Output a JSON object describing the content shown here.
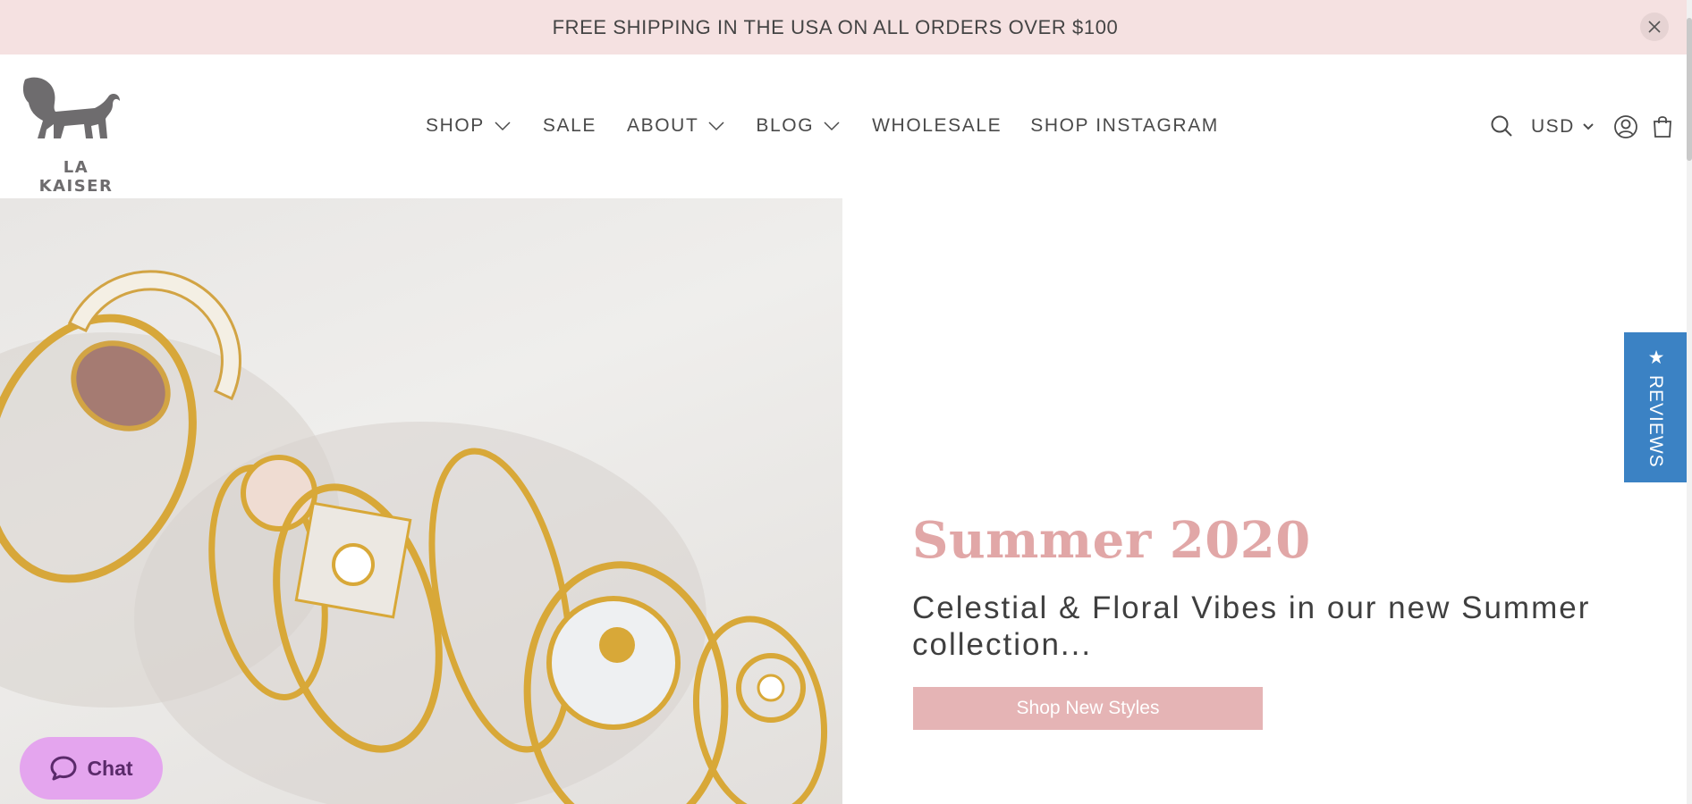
{
  "announcement": {
    "text": "FREE SHIPPING IN THE USA ON ALL ORDERS OVER $100"
  },
  "brand": {
    "name": "LA KAISER"
  },
  "nav": {
    "items": [
      {
        "label": "SHOP",
        "has_dropdown": true
      },
      {
        "label": "SALE",
        "has_dropdown": false
      },
      {
        "label": "ABOUT",
        "has_dropdown": true
      },
      {
        "label": "BLOG",
        "has_dropdown": true
      },
      {
        "label": "WHOLESALE",
        "has_dropdown": false
      },
      {
        "label": "SHOP INSTAGRAM",
        "has_dropdown": false
      }
    ]
  },
  "header_tools": {
    "currency": "USD",
    "icons": [
      "search-icon",
      "account-icon",
      "cart-icon"
    ]
  },
  "hero": {
    "title": "Summer 2020",
    "subtitle": "Celestial & Floral Vibes in our new Summer collection...",
    "cta": "Shop New Styles"
  },
  "reviews_tab": {
    "label": "★ REVIEWS"
  },
  "chat": {
    "label": "Chat"
  },
  "colors": {
    "announcement_bg": "#f5e1e1",
    "accent_pink": "#e1a7a7",
    "button_pink": "#e5b4b5",
    "reviews_blue": "#3b82c4",
    "chat_purple": "#e4a5ee"
  }
}
